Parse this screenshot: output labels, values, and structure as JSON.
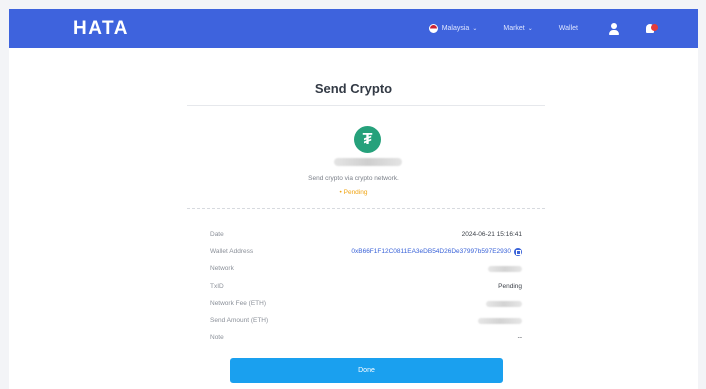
{
  "header": {
    "logo": "HATA",
    "nav": {
      "region": "Malaysia",
      "market": "Market",
      "wallet": "Wallet"
    }
  },
  "page": {
    "title": "Send Crypto",
    "token_icon": "tether-icon",
    "subtitle": "Send crypto via crypto network.",
    "status": "• Pending"
  },
  "details": {
    "rows": [
      {
        "label": "Date",
        "value": "2024-06-21 15:16:41"
      },
      {
        "label": "Wallet Address",
        "value": "0xB66F1F12C0811EA3eDB54D26De37997b597E2930"
      },
      {
        "label": "Network",
        "value": ""
      },
      {
        "label": "TxID",
        "value": "Pending"
      },
      {
        "label": "Network Fee (ETH)",
        "value": ""
      },
      {
        "label": "Send Amount (ETH)",
        "value": ""
      },
      {
        "label": "Note",
        "value": "--"
      }
    ]
  },
  "actions": {
    "done_label": "Done"
  },
  "colors": {
    "brand": "#3e63dd",
    "button": "#1aa0ef",
    "pending": "#f0a515",
    "token": "#26a17b"
  }
}
